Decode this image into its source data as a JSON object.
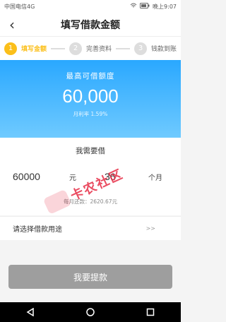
{
  "status_bar": {
    "carrier": "中国电信4G",
    "right_text": "晚上9:07"
  },
  "header": {
    "title": "填写借款金额"
  },
  "steps": [
    {
      "number": "1",
      "label": "填写金额",
      "active": true
    },
    {
      "number": "2",
      "label": "完善资料",
      "active": false
    },
    {
      "number": "3",
      "label": "钱款到账",
      "active": false
    }
  ],
  "banner": {
    "max_title": "最高可借额度",
    "max_amount": "60,000",
    "monthly_rate": "月利率 1.59%"
  },
  "loan": {
    "need_label": "我需要借",
    "amount_value": "60000",
    "amount_unit": "元",
    "months_value": "36",
    "months_unit": "个月",
    "monthly_repayment": "每月还款：2620.67元"
  },
  "purpose": {
    "label": "请选择借款用途",
    "arrow": ">>"
  },
  "submit": {
    "label": "我要提款"
  },
  "watermark": {
    "text": "卡农社区"
  },
  "colors": {
    "accent_yellow": "#fbbf1a",
    "banner_blue": "#2aa8ff",
    "submit_gray": "#9e9e9e"
  }
}
